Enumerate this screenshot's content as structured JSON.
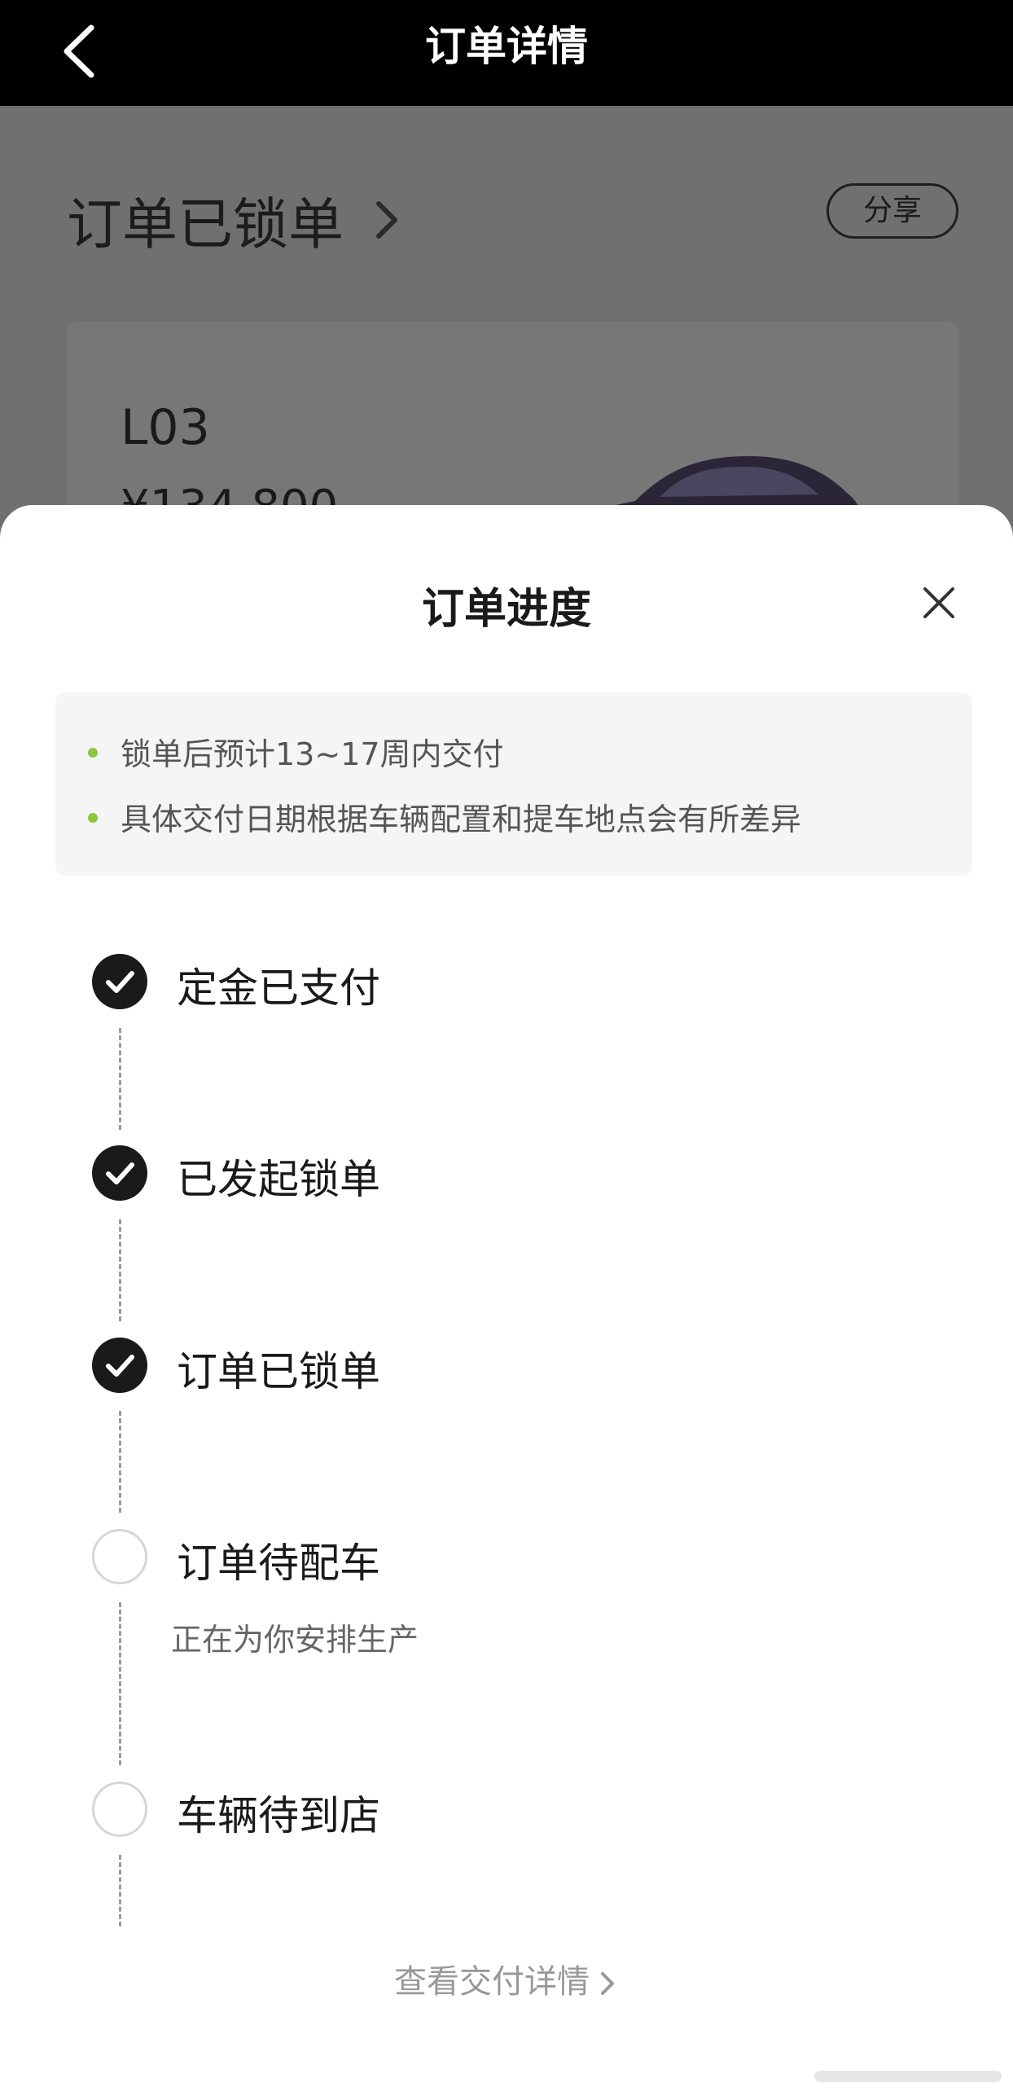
{
  "navbar": {
    "title": "订单详情"
  },
  "background": {
    "order_status": "订单已锁单",
    "share_label": "分享",
    "car_model": "L03",
    "car_price": "¥134,800"
  },
  "sheet": {
    "title": "订单进度",
    "notices": [
      "锁单后预计13~17周内交付",
      "具体交付日期根据车辆配置和提车地点会有所差异"
    ],
    "steps": [
      {
        "label": "定金已支付",
        "status": "done"
      },
      {
        "label": "已发起锁单",
        "status": "done"
      },
      {
        "label": "订单已锁单",
        "status": "done"
      },
      {
        "label": "订单待配车",
        "status": "pending",
        "sub": "正在为你安排生产"
      },
      {
        "label": "车辆待到店",
        "status": "pending"
      }
    ],
    "footer_link": "查看交付详情"
  },
  "colors": {
    "accent": "#8ec63f",
    "done": "#1a1a1a",
    "navbar": "#000000"
  }
}
